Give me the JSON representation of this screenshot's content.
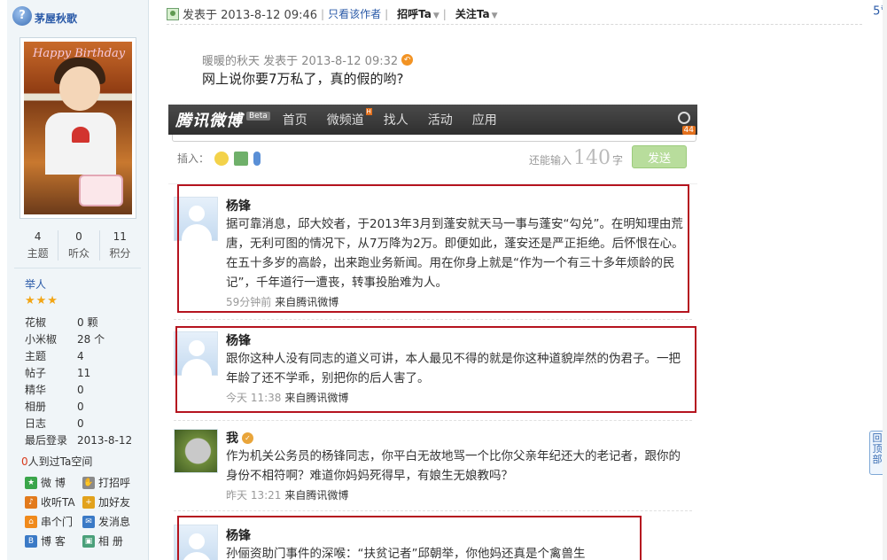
{
  "sidebar": {
    "username": "茅屋秋歌",
    "stats": [
      {
        "num": "4",
        "label": "主题"
      },
      {
        "num": "0",
        "label": "听众"
      },
      {
        "num": "11",
        "label": "积分"
      }
    ],
    "level": "举人",
    "stars": "★★★",
    "info": [
      {
        "k": "花椒",
        "v": "0 颗"
      },
      {
        "k": "小米椒",
        "v": "28 个"
      },
      {
        "k": "主题",
        "v": "4"
      },
      {
        "k": "帖子",
        "v": "11"
      },
      {
        "k": "精华",
        "v": "0"
      },
      {
        "k": "相册",
        "v": "0"
      },
      {
        "k": "日志",
        "v": "0"
      },
      {
        "k": "最后登录",
        "v": "2013-8-12"
      }
    ],
    "visited_num": "0",
    "visited_text": "人到过Ta空间",
    "actions": [
      {
        "label": "微 博",
        "icon": "weibo-icon",
        "color": "#3aa54a"
      },
      {
        "label": "打招呼",
        "icon": "wave-icon",
        "color": "#8a8a8a"
      },
      {
        "label": "收听TA",
        "icon": "listen-icon",
        "color": "#e27a1c"
      },
      {
        "label": "加好友",
        "icon": "add-friend-icon",
        "color": "#e2a21c"
      },
      {
        "label": "串个门",
        "icon": "home-icon",
        "color": "#f08a1c"
      },
      {
        "label": "发消息",
        "icon": "mail-icon",
        "color": "#3b7ac6"
      },
      {
        "label": "博 客",
        "icon": "blog-icon",
        "color": "#3b7ac6"
      },
      {
        "label": "相 册",
        "icon": "album-icon",
        "color": "#4aa07a"
      }
    ]
  },
  "post": {
    "published": "发表于 2013-8-12 09:46",
    "only_author": "只看该作者",
    "greet": "招呼Ta",
    "follow": "关注Ta",
    "floor": "5",
    "floor_mark": "#",
    "quote_meta": "暖暖的秋天 发表于 2013-8-12 09:32",
    "quote_text": "网上说你要7万私了，真的假的哟?"
  },
  "weibo": {
    "logo": "腾讯微博",
    "beta": "Beta",
    "nav": [
      "首页",
      "微频道",
      "找人",
      "活动",
      "应用"
    ],
    "hot": "H",
    "badge": "44",
    "insert_label": "插入：",
    "count_prefix": "还能输入",
    "count": "140",
    "count_suffix": "字",
    "send": "发送",
    "tweets": [
      {
        "name": "杨锋",
        "body": "据可靠消息，邱大姣者，于2013年3月到蓬安就天马一事与蓬安“勾兑”。在明知理由荒唐，无利可图的情况下，从7万降为2万。即便如此，蓬安还是严正拒绝。后怀恨在心。在五十多岁的高龄，出来跑业务新闻。用在你身上就是“作为一个有三十多年烦龄的民记”，千年道行一遭丧，转事投胎难为人。",
        "time": "59分钟前",
        "source": "来自腾讯微博"
      },
      {
        "name": "杨锋",
        "body": "跟你这种人没有同志的道义可讲，本人最见不得的就是你这种道貌岸然的伪君子。一把年龄了还不学乖，别把你的后人害了。",
        "time": "今天 11:38",
        "source": "来自腾讯微博"
      },
      {
        "name": "我",
        "body": "作为机关公务员的杨锋同志，你平白无故地骂一个比你父亲年纪还大的老记者，跟你的身份不相符啊？难道你妈妈死得早，有娘生无娘教吗？",
        "time": "昨天 13:21",
        "source": "来自腾讯微博"
      },
      {
        "name": "杨锋",
        "body": "孙俪资助门事件的深喉：“扶贫记者”邱朝举，你他妈还真是个禽兽生"
      }
    ]
  },
  "to_top": "回顶部",
  "colors": {
    "link": "#2a5aa8",
    "highlight_box": "#b5141f",
    "send_button": "#b8dd9c"
  }
}
